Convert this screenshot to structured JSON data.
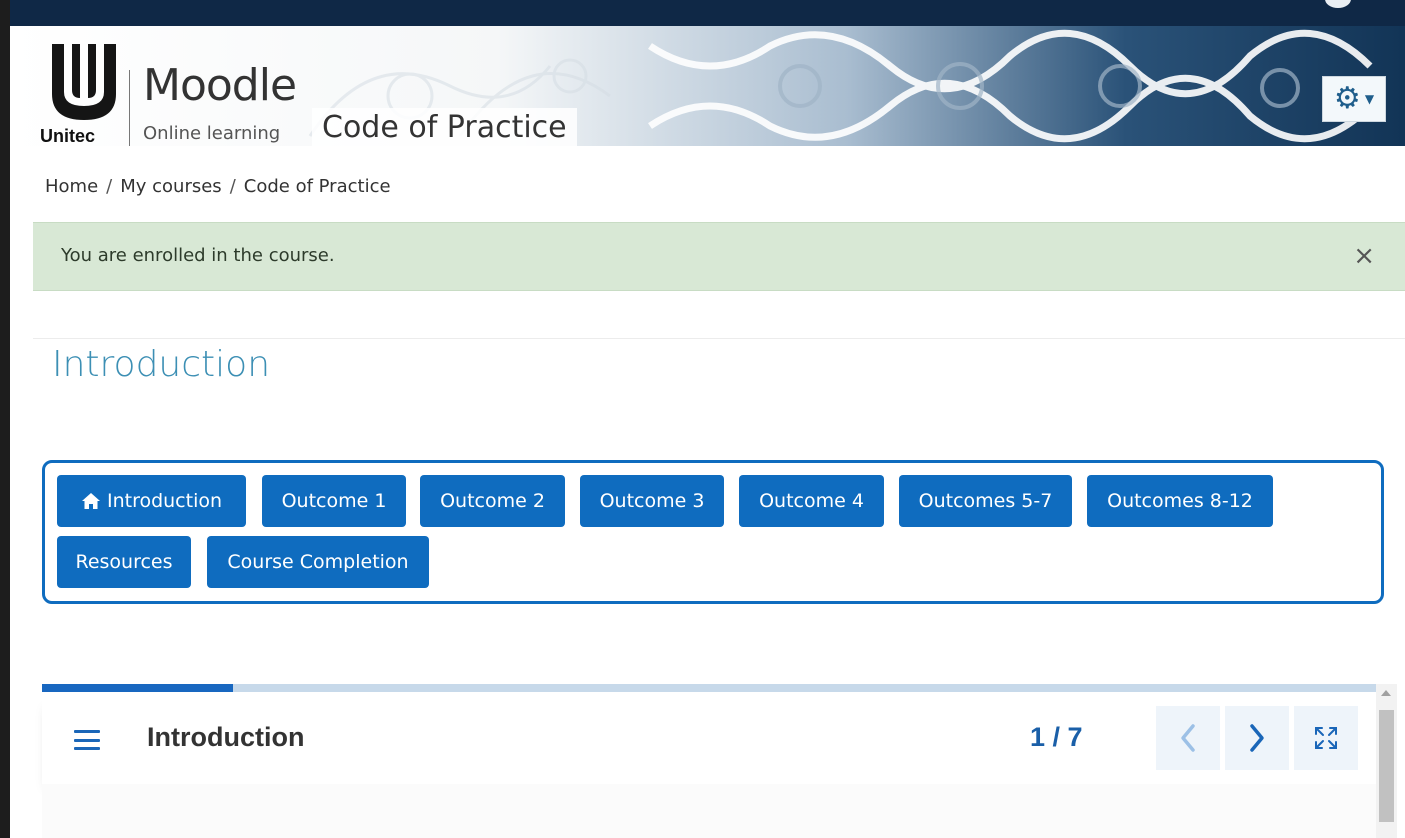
{
  "header": {
    "logo_brand": "Unitec",
    "app_name": "Moodle",
    "app_tagline": "Online learning",
    "course_title": "Code of Practice",
    "settings_icon": "gear-icon"
  },
  "breadcrumb": {
    "items": [
      "Home",
      "My courses",
      "Code of Practice"
    ],
    "separator": "/"
  },
  "alert": {
    "message": "You are enrolled in the course.",
    "close_label": "×"
  },
  "section": {
    "title": "Introduction"
  },
  "nav": {
    "buttons": [
      {
        "label": "Introduction",
        "icon": "home-icon"
      },
      {
        "label": "Outcome 1"
      },
      {
        "label": "Outcome 2"
      },
      {
        "label": "Outcome 3"
      },
      {
        "label": "Outcome 4"
      },
      {
        "label": "Outcomes 5-7"
      },
      {
        "label": "Outcomes 8-12"
      },
      {
        "label": "Resources"
      },
      {
        "label": "Course Completion"
      }
    ]
  },
  "book": {
    "title": "Introduction",
    "page_counter": "1 / 7",
    "progress_fraction": 0.143
  },
  "colors": {
    "primary": "#0f6cbf",
    "section_title": "#3c8fb4",
    "alert_bg": "#d8e8d5",
    "header_dark": "#0f2846"
  }
}
